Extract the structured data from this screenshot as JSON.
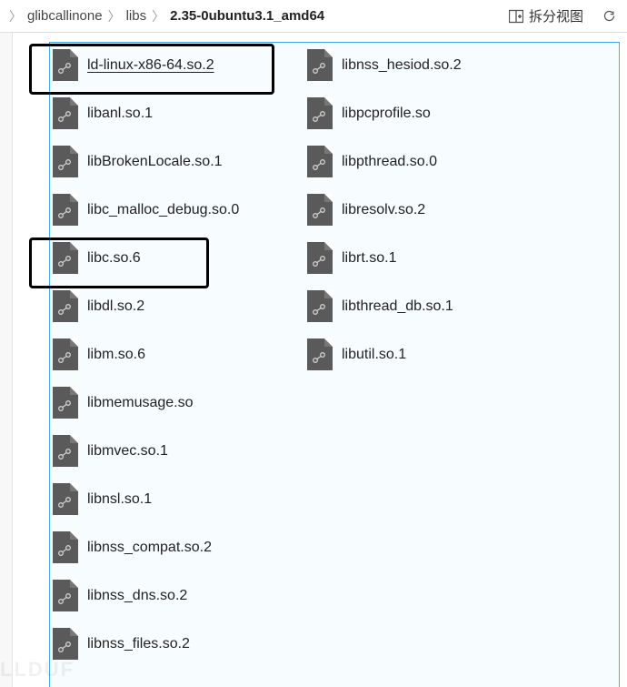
{
  "breadcrumb": {
    "segments": [
      "glibcallinone",
      "libs",
      "2.35-0ubuntu3.1_amd64"
    ]
  },
  "toolbar": {
    "split_view_label": "拆分视图"
  },
  "files": {
    "col1": [
      {
        "name": "ld-linux-x86-64.so.2",
        "selected": true
      },
      {
        "name": "libanl.so.1"
      },
      {
        "name": "libBrokenLocale.so.1"
      },
      {
        "name": "libc_malloc_debug.so.0"
      },
      {
        "name": "libc.so.6"
      },
      {
        "name": "libdl.so.2"
      },
      {
        "name": "libm.so.6"
      },
      {
        "name": "libmemusage.so"
      },
      {
        "name": "libmvec.so.1"
      },
      {
        "name": "libnsl.so.1"
      },
      {
        "name": "libnss_compat.so.2"
      },
      {
        "name": "libnss_dns.so.2"
      },
      {
        "name": "libnss_files.so.2"
      }
    ],
    "col2": [
      {
        "name": "libnss_hesiod.so.2"
      },
      {
        "name": "libpcprofile.so"
      },
      {
        "name": "libpthread.so.0"
      },
      {
        "name": "libresolv.so.2"
      },
      {
        "name": "librt.so.1"
      },
      {
        "name": "libthread_db.so.1"
      },
      {
        "name": "libutil.so.1"
      }
    ]
  },
  "watermark": "LLDUF"
}
